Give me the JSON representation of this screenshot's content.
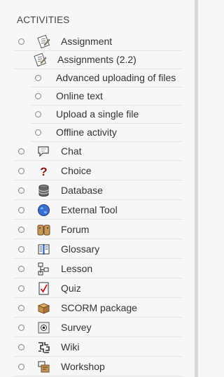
{
  "section": {
    "heading": "ACTIVITIES"
  },
  "activities": [
    {
      "label": "Assignment",
      "icon": "assignment-icon"
    },
    {
      "label": "Assignments (2.2)",
      "icon": "assignment-icon"
    },
    {
      "label": "Advanced uploading of files"
    },
    {
      "label": "Online text"
    },
    {
      "label": "Upload a single file"
    },
    {
      "label": "Offline activity"
    },
    {
      "label": "Chat",
      "icon": "chat-icon"
    },
    {
      "label": "Choice",
      "icon": "question-icon"
    },
    {
      "label": "Database",
      "icon": "database-icon"
    },
    {
      "label": "External Tool",
      "icon": "globe-icon"
    },
    {
      "label": "Forum",
      "icon": "forum-icon"
    },
    {
      "label": "Glossary",
      "icon": "glossary-icon"
    },
    {
      "label": "Lesson",
      "icon": "lesson-icon"
    },
    {
      "label": "Quiz",
      "icon": "quiz-icon"
    },
    {
      "label": "SCORM package",
      "icon": "package-icon"
    },
    {
      "label": "Survey",
      "icon": "survey-icon"
    },
    {
      "label": "Wiki",
      "icon": "wiki-icon"
    },
    {
      "label": "Workshop",
      "icon": "workshop-icon"
    }
  ]
}
